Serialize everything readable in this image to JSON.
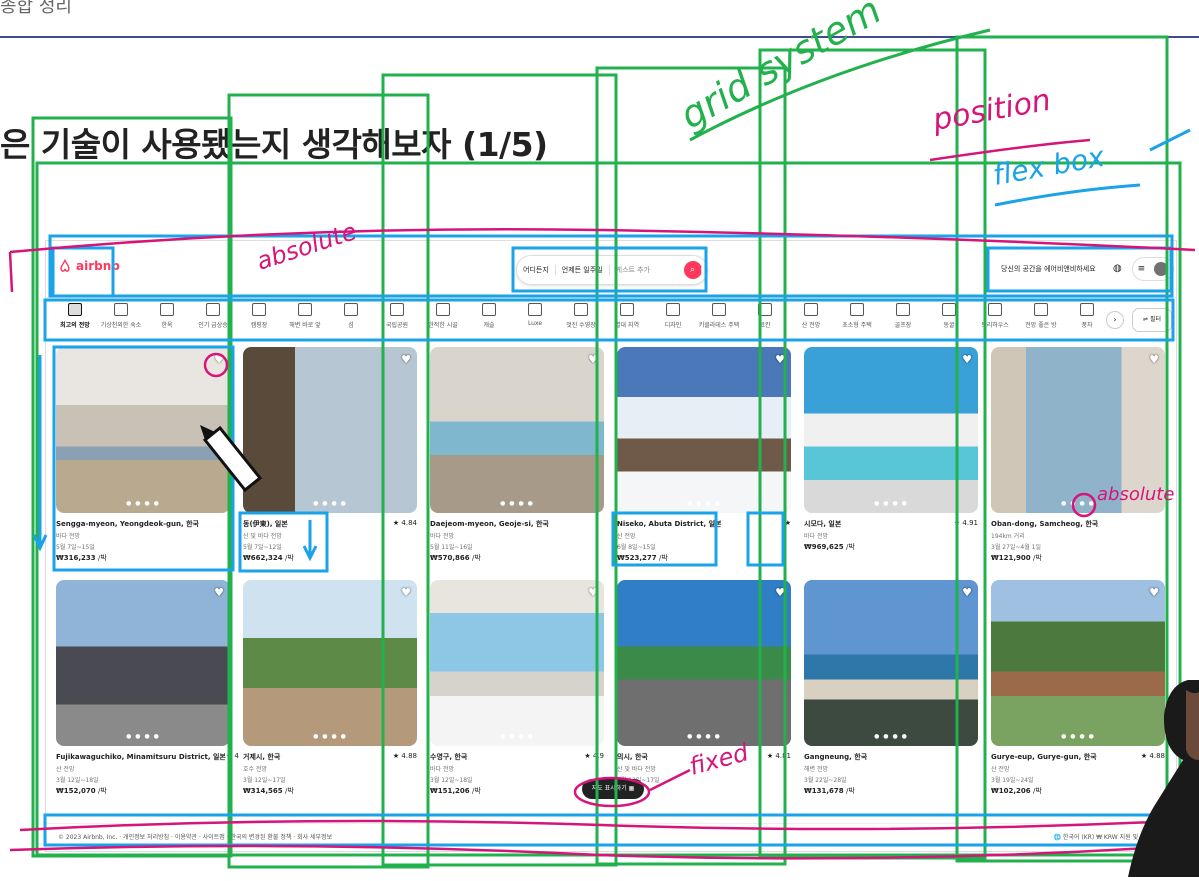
{
  "slide": {
    "top_title": "종합 정리",
    "heading": "은 기술이 사용됐는지 생각해보자 (1/5)"
  },
  "app": {
    "logo": "airbnb",
    "search": {
      "where": "어디든지",
      "week": "언제든 일주일",
      "guests": "게스트 추가"
    },
    "host_link": "당신의 공간을 에어비앤비하세요"
  },
  "categories": [
    "최고의 전망",
    "기상천외한 숙소",
    "한옥",
    "인기 급상승",
    "캠핑장",
    "해변 바로 앞",
    "섬",
    "국립공원",
    "한적한 시골",
    "캐슬",
    "Luxe",
    "멋진 수영장",
    "열대 지역",
    "디자인",
    "키클라데스 주택",
    "료칸",
    "산 전망",
    "초소형 주택",
    "골프장",
    "동굴",
    "트리하우스",
    "전망 좋은 방",
    "풍차"
  ],
  "filter_label": "필터",
  "listings": [
    {
      "location": "Sengga-myeon, Yeongdeok-gun, 한국",
      "rating": "",
      "desc": "바다 전망",
      "dates": "5월 7일~15일",
      "price": "₩316,233",
      "unit": "/박",
      "img": "living"
    },
    {
      "location": "동(伊東), 일본",
      "rating": "★ 4.84",
      "desc": "산 및 바다 전망",
      "dates": "5월 7일~12일",
      "price": "₩662,324",
      "unit": "/박",
      "img": "glasshouse"
    },
    {
      "location": "Daejeom-myeon, Geoje-si, 한국",
      "rating": "",
      "desc": "바다 전망",
      "dates": "5월 11일~16일",
      "price": "₩570,866",
      "unit": "/박",
      "img": "pool"
    },
    {
      "location": "Niseko, Abuta District, 일본",
      "rating": "★",
      "desc": "산 전망",
      "dates": "6월 8일~15일",
      "price": "₩523,277",
      "unit": "/박",
      "img": "snow"
    },
    {
      "location": "시모다, 일본",
      "rating": "★ 4.91",
      "desc": "바다 전망",
      "dates": "",
      "price": "₩969,625",
      "unit": "/박",
      "img": "jacuzzi"
    },
    {
      "location": "Oban-dong, Samcheog, 한국",
      "rating": "",
      "desc": "194km 거리",
      "dates": "3월 27일~4월 1일",
      "price": "₩121,900",
      "unit": "/박",
      "img": "room"
    },
    {
      "location": "Fujikawaguchiko, Minamitsuru District, 일본",
      "rating": "★ 4",
      "desc": "산 전망",
      "dates": "3월 12일~18일",
      "price": "₩152,070",
      "unit": "/박",
      "img": "cabin"
    },
    {
      "location": "거제시, 한국",
      "rating": "★ 4.88",
      "desc": "호수 전망",
      "dates": "3월 12일~17일",
      "price": "₩314,565",
      "unit": "/박",
      "img": "terrace"
    },
    {
      "location": "수영구, 한국",
      "rating": "★ 4.9",
      "desc": "바다 전망",
      "dates": "3월 12일~18일",
      "price": "₩151,206",
      "unit": "/박",
      "img": "bedroom"
    },
    {
      "location": "의시, 한국",
      "rating": "★ 4.81",
      "desc": "산 및 바다 전망",
      "dates": "3월 12일~17일",
      "price": "",
      "unit": "",
      "img": "balcony"
    },
    {
      "location": "Gangneung, 한국",
      "rating": "",
      "desc": "해변 전망",
      "dates": "3월 22일~28일",
      "price": "₩131,678",
      "unit": "/박",
      "img": "beach"
    },
    {
      "location": "Gurye-eup, Gurye-gun, 한국",
      "rating": "★ 4.88",
      "desc": "산 전망",
      "dates": "3월 19일~24일",
      "price": "₩102,206",
      "unit": "/박",
      "img": "village"
    }
  ],
  "map_button": "지도 표시하기 ▦",
  "footer": {
    "left": "© 2023 Airbnb, Inc. · 개인정보 처리방침 · 이용약관 · 사이트맵 · 한국의 변경된 환불 정책 · 회사 세부정보",
    "right": "🌐 한국어 (KR)   ₩ KRW   지원 및 참고 자료"
  },
  "annotations": {
    "absolute1": "absolute",
    "grid": "grid system",
    "position": "position",
    "flexbox": "flex box",
    "absolute2": "absolute",
    "fixed": "fixed"
  },
  "colors": {
    "brand": "#ff385c",
    "box_green": "#22b14c",
    "box_blue": "#1aa3e8",
    "ink_pink": "#d6157a"
  }
}
